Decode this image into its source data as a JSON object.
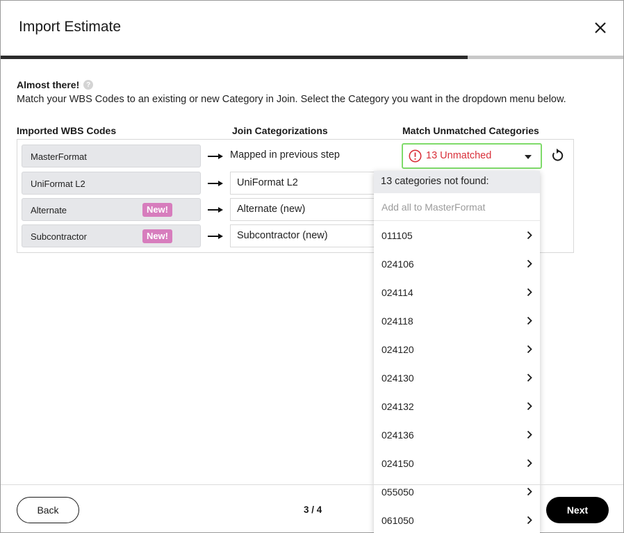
{
  "dialog": {
    "title": "Import Estimate",
    "progress": 0.75
  },
  "intro": {
    "heading": "Almost there!",
    "description": "Match your WBS Codes to an existing or new Category in Join. Select the Category you want in the dropdown menu below."
  },
  "columns": {
    "imported": "Imported WBS Codes",
    "join": "Join Categorizations",
    "match": "Match Unmatched Categories"
  },
  "rows": [
    {
      "wbs": "MasterFormat",
      "badge": "",
      "join": "Mapped in previous step"
    },
    {
      "wbs": "UniFormat L2",
      "badge": "",
      "join": "UniFormat L2"
    },
    {
      "wbs": "Alternate",
      "badge": "New!",
      "join": "Alternate (new)"
    },
    {
      "wbs": "Subcontractor",
      "badge": "New!",
      "join": "Subcontractor (new)"
    }
  ],
  "match_select": {
    "label": "13 Unmatched",
    "status_color": "#d9303a"
  },
  "dropdown": {
    "header": "13 categories not found:",
    "add_all": "Add all to MasterFormat",
    "items": [
      "011105",
      "024106",
      "024114",
      "024118",
      "024120",
      "024130",
      "024132",
      "024136",
      "024150",
      "055050",
      "061050"
    ]
  },
  "footer": {
    "back_label": "Back",
    "step": "3 / 4",
    "next_label": "Next"
  }
}
